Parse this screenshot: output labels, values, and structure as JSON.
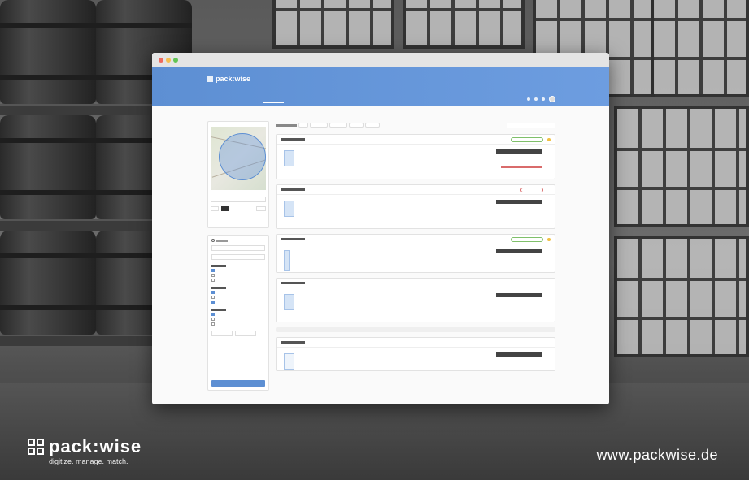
{
  "brand": {
    "name": "pack:wise",
    "tagline": "digitize. manage. match.",
    "website": "www.packwise.de"
  },
  "app": {
    "logo_text": "pack:wise",
    "user_label": "",
    "nav_tabs": [
      "",
      "",
      "",
      "",
      ""
    ],
    "sort_label": ""
  },
  "colors": {
    "primary": "#5d8fd3",
    "badge_green": "#7fc06a",
    "badge_red": "#d96b6b"
  }
}
